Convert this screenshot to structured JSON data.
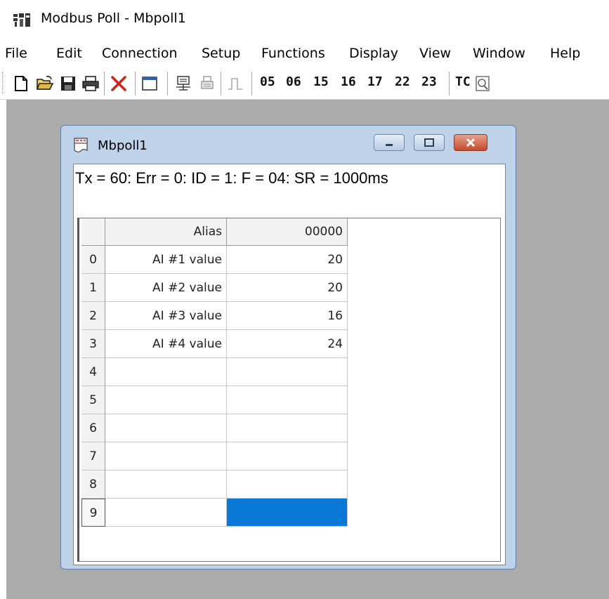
{
  "app": {
    "title": "Modbus Poll - Mbpoll1",
    "icon": "modbus-poll-app-icon"
  },
  "menu": [
    "File",
    "Edit",
    "Connection",
    "Setup",
    "Functions",
    "Display",
    "View",
    "Window",
    "Help"
  ],
  "toolbar": {
    "icons": [
      "new-document-icon",
      "open-folder-icon",
      "save-disk-icon",
      "print-icon",
      "disconnect-x-icon",
      "window-icon",
      "read-write-icon",
      "print-grey-icon",
      "pulse-icon"
    ],
    "function_codes": [
      "05",
      "06",
      "15",
      "16",
      "17",
      "22",
      "23"
    ],
    "tc_label": "TC"
  },
  "child_window": {
    "title": "Mbpoll1",
    "icon": "doc-icon",
    "status": "Tx = 60: Err = 0: ID = 1: F = 04: SR = 1000ms"
  },
  "grid": {
    "columns": [
      "Alias",
      "00000"
    ],
    "rows": [
      {
        "index": "0",
        "alias": "AI #1 value",
        "value": "20"
      },
      {
        "index": "1",
        "alias": "AI #2 value",
        "value": "20"
      },
      {
        "index": "2",
        "alias": "AI #3 value",
        "value": "16"
      },
      {
        "index": "3",
        "alias": "AI #4 value",
        "value": "24"
      },
      {
        "index": "4",
        "alias": "",
        "value": ""
      },
      {
        "index": "5",
        "alias": "",
        "value": ""
      },
      {
        "index": "6",
        "alias": "",
        "value": ""
      },
      {
        "index": "7",
        "alias": "",
        "value": ""
      },
      {
        "index": "8",
        "alias": "",
        "value": ""
      },
      {
        "index": "9",
        "alias": "",
        "value": ""
      }
    ],
    "selected_color": "#0a78d7"
  }
}
